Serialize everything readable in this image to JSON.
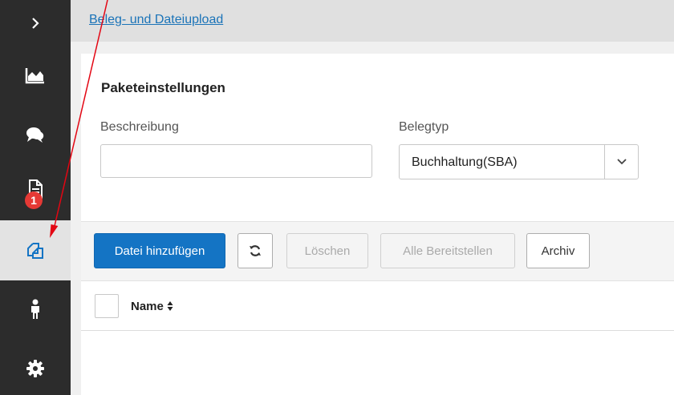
{
  "sidebar": {
    "items": [
      {
        "icon": "chevron-right-icon"
      },
      {
        "icon": "area-chart-icon"
      },
      {
        "icon": "chat-bubbles-icon"
      },
      {
        "icon": "document-icon",
        "badge": "1"
      },
      {
        "icon": "copy-files-icon",
        "active": true
      },
      {
        "icon": "person-icon"
      },
      {
        "icon": "gear-icon"
      }
    ]
  },
  "breadcrumb": {
    "label": "Beleg- und Dateiupload"
  },
  "settings": {
    "title": "Paketeinstellungen",
    "description_label": "Beschreibung",
    "description_value": "",
    "type_label": "Belegtyp",
    "type_value": "Buchhaltung(SBA)"
  },
  "toolbar": {
    "add_label": "Datei hinzufügen",
    "delete_label": "Löschen",
    "release_all_label": "Alle Bereitstellen",
    "archive_label": "Archiv"
  },
  "table": {
    "columns": [
      "Name"
    ]
  },
  "colors": {
    "sidebar": "#2c2c2c",
    "primary": "#1474c4",
    "badge": "#e53935",
    "annotation": "#e30613"
  }
}
